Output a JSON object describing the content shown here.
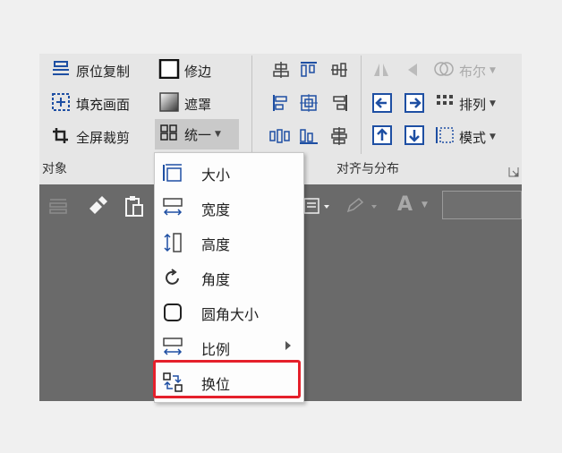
{
  "ribbon": {
    "object_group": {
      "label": "对象",
      "copy_position": "原位复制",
      "fill_screen": "填充画面",
      "fullscreen_crop": "全屏裁剪",
      "trim_edge": "修边",
      "mask": "遮罩",
      "unify": "统一"
    },
    "align_group": {
      "label": "对齐与分布",
      "boolean": "布尔",
      "arrange": "排列",
      "mode": "模式"
    }
  },
  "dropdown_menu": {
    "items": [
      {
        "label": "大小"
      },
      {
        "label": "宽度"
      },
      {
        "label": "高度"
      },
      {
        "label": "角度"
      },
      {
        "label": "圆角大小"
      },
      {
        "label": "比例"
      },
      {
        "label": "换位"
      }
    ]
  },
  "toolbar": {
    "font_icon_label": "A"
  },
  "colors": {
    "ribbon_bg": "#e6e6e6",
    "dark_bg": "#6a6a6a",
    "accent_blue": "#1e4fa3",
    "highlight_red": "#e5202b"
  }
}
